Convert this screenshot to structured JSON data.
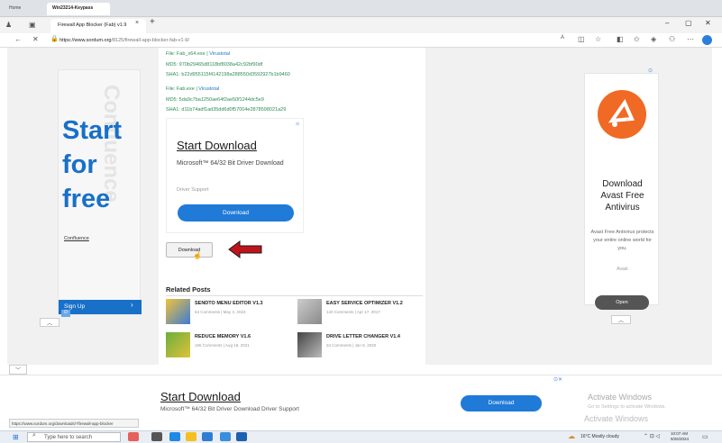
{
  "outer_tabs": [
    {
      "label": "Home"
    },
    {
      "label": "Win23214-Keypass"
    }
  ],
  "browser": {
    "tab_title": "Firewall App Blocker (Fab) v1.9",
    "close_glyph": "×",
    "new_tab_glyph": "+",
    "url_host": "https://www.sordum.org",
    "url_path": "/8125/firewall-app-blocker-fab-v1-9/",
    "window_controls": {
      "minimize": "–",
      "maximize": "▢",
      "close": "✕"
    }
  },
  "files": [
    {
      "name": "File: Fab_x64.exe",
      "link": "Virustotal",
      "md5": "MD5: 970b29465d8118bf8038a42c92bf90df",
      "sha1": "SHA1: b22d955115f4142198a288550d3592927b1b9460"
    },
    {
      "name": "File: Fab.exe",
      "link": "Virustotal",
      "md5": "MD5: 5da9c7ba1250ae64f2ae50f1244dc5e9",
      "sha1": "SHA1: d11b74adf1ad35dd6d0f57004e2878598021a29"
    }
  ],
  "inline_ad": {
    "title": "Start Download",
    "subtitle": "Microsoft™ 64/32 Bit Driver Download",
    "support": "Driver Support",
    "button": "Download"
  },
  "download_button": "Download",
  "related": {
    "title": "Related Posts",
    "posts": [
      {
        "title": "SENDTO MENU EDITOR V1.3",
        "meta": "54 Comments | May 3, 2023"
      },
      {
        "title": "EASY SERVICE OPTIMIZER V1.2",
        "meta": "140 Comments | Apr 17, 2017"
      },
      {
        "title": "REDUCE MEMORY V1.6",
        "meta": "155 Comments | Aug 18, 2021"
      },
      {
        "title": "DRIVE LETTER CHANGER V1.4",
        "meta": "34 Comments | Jan 8, 2020"
      }
    ]
  },
  "left_ad": {
    "headline": "Start\nfor\nfree",
    "watermark": "Confluence",
    "brand": "Confluence",
    "signup": "Sign Up",
    "arrow": "›",
    "badge": "D"
  },
  "right_ad": {
    "headline": "Download\nAvast Free\nAntivirus",
    "description": "Avast Free Antivirus protects your entire online world for you.",
    "brand": "Avast",
    "button": "Open"
  },
  "bottom_ad": {
    "title": "Start Download",
    "subtitle": "Microsoft™ 64/32 Bit Driver Download Driver Support",
    "button": "Download"
  },
  "activation": {
    "line1": "Activate Windows",
    "line2": "Go to Settings to activate Windows.",
    "line3": "Activate Windows"
  },
  "status_url": "https://www.sordum.org/downloads/?firewall-app-blocker",
  "taskbar": {
    "search_placeholder": "Type here to search",
    "weather": "16°C  Mostly cloudy",
    "time": "10:07 AM",
    "date": "9/26/2024"
  },
  "colors": {
    "accent": "#1f7ad8",
    "avast": "#f06a25",
    "hash_text": "#2e8b57",
    "arrow_red": "#c0141c"
  }
}
